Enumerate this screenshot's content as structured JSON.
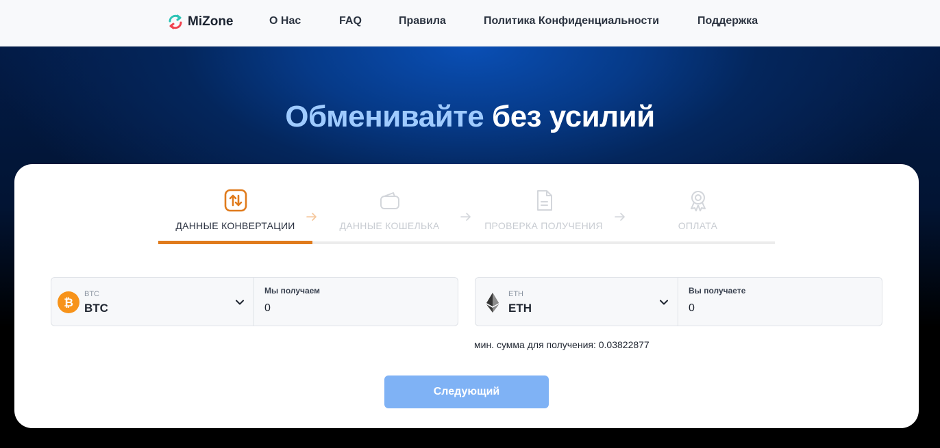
{
  "header": {
    "logo_text": "MiZone",
    "nav": [
      "О Нас",
      "FAQ",
      "Правила",
      "Политика Конфиденциальности",
      "Поддержка"
    ]
  },
  "hero": {
    "title_accent": "Обменивайте",
    "title_rest": "без усилий"
  },
  "steps": [
    {
      "label": "ДАННЫЕ КОНВЕРТАЦИИ",
      "icon": "swap-arrows-icon",
      "active": true
    },
    {
      "label": "ДАННЫЕ КОШЕЛЬКА",
      "icon": "wallet-icon",
      "active": false
    },
    {
      "label": "ПРОВЕРКА ПОЛУЧЕНИЯ",
      "icon": "document-icon",
      "active": false
    },
    {
      "label": "ОПЛАТА",
      "icon": "award-icon",
      "active": false
    }
  ],
  "send": {
    "currency_small": "BTC",
    "currency_big": "BTC",
    "amount_label": "Мы получаем",
    "amount_value": "0"
  },
  "receive": {
    "currency_small": "ETH",
    "currency_big": "ETH",
    "amount_label": "Вы получаете",
    "amount_value": "0"
  },
  "min_note": "мин. сумма для получения: 0.03822877",
  "next_label": "Следующий",
  "colors": {
    "accent_orange": "#e07b1c",
    "btc_orange": "#f7931a",
    "button_blue": "#7fb2f5",
    "hero_accent": "#9fcbff"
  }
}
